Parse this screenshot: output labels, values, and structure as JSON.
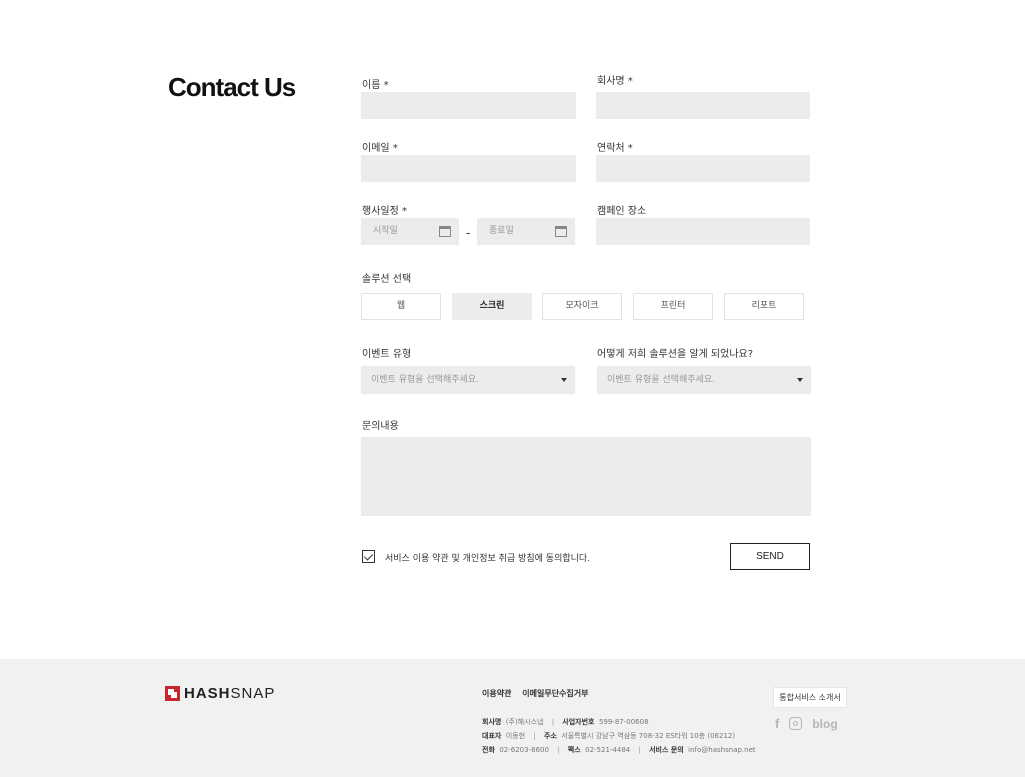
{
  "page": {
    "title": "Contact Us"
  },
  "form": {
    "name_label": "이름 *",
    "company_label": "회사명 *",
    "email_label": "이메일 *",
    "phone_label": "연락처 *",
    "schedule_label": "행사일정 *",
    "start_placeholder": "시작일",
    "end_placeholder": "종료일",
    "date_separator": "-",
    "venue_label": "캠페인 장소",
    "solution_label": "솔루션 선택",
    "solutions": [
      "웹",
      "스크린",
      "모자이크",
      "프린터",
      "리포트"
    ],
    "selected_solution": "스크린",
    "event_type_label": "이벤트 유형",
    "event_type_placeholder": "이벤트 유형을 선택해주세요.",
    "referral_label": "어떻게 저희 솔루션을 알게 되었나요?",
    "referral_placeholder": "이벤트 유형을 선택해주세요.",
    "inquiry_label": "문의내용",
    "agree_text": "서비스 이용 약관 및 개인정보 취급 방침에 동의합니다.",
    "agree_checked": true,
    "send_label": "SEND"
  },
  "footer": {
    "logo_bold": "HASH",
    "logo_light": "SNAP",
    "links": [
      "이용약관",
      "이메일무단수집거부"
    ],
    "company_name_label": "회사명",
    "company_name": "(주)해시스냅",
    "biz_no_label": "사업자번호",
    "biz_no": "599-87-00608",
    "ceo_label": "대표자",
    "ceo": "이동현",
    "address_label": "주소",
    "address": "서울특별시 강남구 역삼동 708-32 ES타워 10층 (06212)",
    "tel_label": "전화",
    "tel": "02-6203-8600",
    "fax_label": "팩스",
    "fax": "02-521-4484",
    "service_label": "서비스 문의",
    "service_email": "info@hashsnap.net",
    "intro_button": "통합서비스 소개서",
    "social": {
      "facebook": "f",
      "blog": "blog"
    }
  },
  "colors": {
    "accent": "#c8262d",
    "field_bg": "#ececec",
    "footer_bg": "#f1f1f1"
  }
}
